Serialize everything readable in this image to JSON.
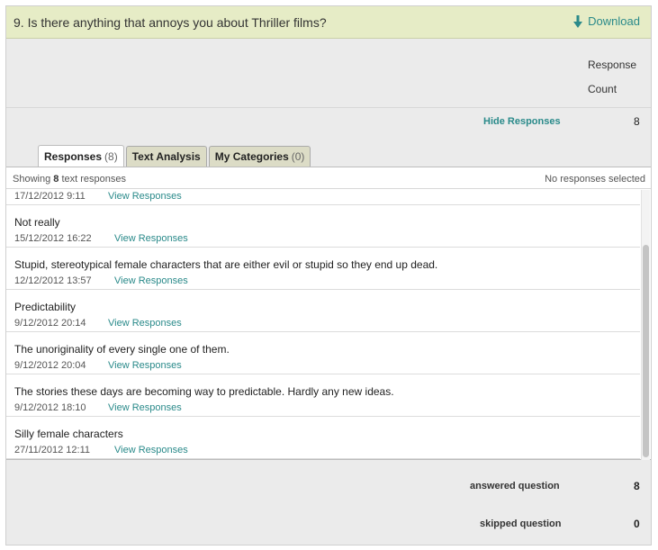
{
  "question": {
    "title": "9. Is there anything that annoys you about Thriller films?",
    "download_label": "Download"
  },
  "response_count_label": [
    "Response",
    "Count"
  ],
  "hide_responses_label": "Hide Responses",
  "hide_responses_count": "8",
  "tabs": [
    {
      "label": "Responses",
      "count": "(8)",
      "active": true
    },
    {
      "label": "Text Analysis",
      "count": "",
      "active": false
    },
    {
      "label": "My Categories",
      "count": "(0)",
      "active": false
    }
  ],
  "panel": {
    "showing_prefix": "Showing",
    "showing_count": "8",
    "showing_suffix": "text responses",
    "selection_status": "No responses selected"
  },
  "responses": [
    {
      "text": "",
      "date": "17/12/2012 9:11",
      "link": "View Responses"
    },
    {
      "text": "Not really",
      "date": "15/12/2012 16:22",
      "link": "View Responses"
    },
    {
      "text": "Stupid, stereotypical female characters that are either evil or stupid so they end up dead.",
      "date": "12/12/2012 13:57",
      "link": "View Responses"
    },
    {
      "text": "Predictability",
      "date": "9/12/2012 20:14",
      "link": "View Responses"
    },
    {
      "text": "The unoriginality of every single one of them.",
      "date": "9/12/2012 20:04",
      "link": "View Responses"
    },
    {
      "text": "The stories these days are becoming way to predictable. Hardly any new ideas.",
      "date": "9/12/2012 18:10",
      "link": "View Responses"
    },
    {
      "text": "Silly female characters",
      "date": "27/11/2012 12:11",
      "link": "View Responses"
    }
  ],
  "footer": {
    "answered_label": "answered question",
    "answered_value": "8",
    "skipped_label": "skipped question",
    "skipped_value": "0"
  },
  "colors": {
    "header_bg": "#e6ecc6",
    "link": "#2a8a8a",
    "panel_bg": "#ebebeb"
  },
  "icons": {
    "download": "arrow-down-icon"
  }
}
